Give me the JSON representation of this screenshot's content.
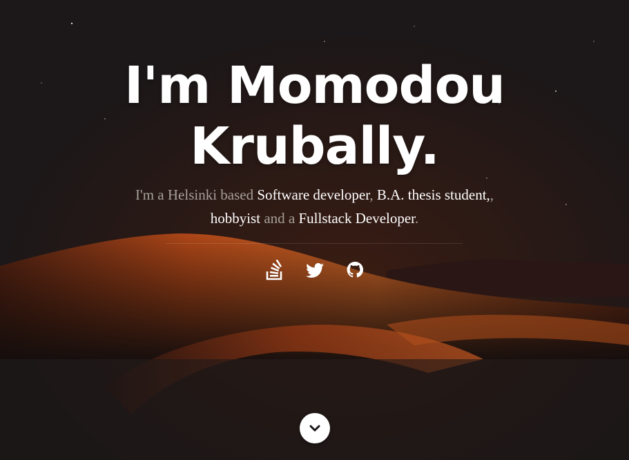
{
  "hero": {
    "headline_line1": "I'm Momodou",
    "headline_line2": "Krubally.",
    "intro": {
      "prefix": "I'm a Helsinki based ",
      "role1": "Software developer",
      "sep1": ", ",
      "role2": "B.A. thesis student,",
      "sep2": ", ",
      "role3": "hobbyist",
      "sep3": " and a ",
      "role4": "Fullstack Developer",
      "suffix": "."
    }
  },
  "social": [
    {
      "name": "stackoverflow-icon"
    },
    {
      "name": "twitter-icon"
    },
    {
      "name": "github-icon"
    }
  ],
  "scroll": {
    "icon": "chevron-down-icon"
  },
  "colors": {
    "background": "#1c1718",
    "sand": "#c8501a",
    "highlight_text": "#ffffff",
    "muted_text": "#a6a09a"
  }
}
